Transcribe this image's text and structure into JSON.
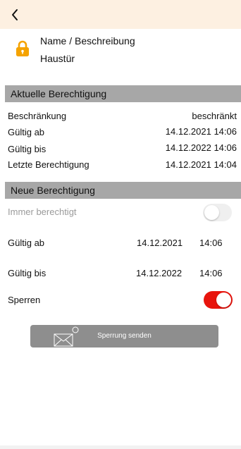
{
  "header": {
    "name_label": "Name / Beschreibung",
    "name_value": "Haustür"
  },
  "current": {
    "title": "Aktuelle Berechtigung",
    "rows": [
      {
        "label": "Beschränkung",
        "value": "beschränkt"
      },
      {
        "label": "Gültig ab",
        "value": "14.12.2021 14:06"
      },
      {
        "label": "Gültig bis",
        "value": "14.12.2022 14:06"
      },
      {
        "label": "Letzte Berechtigung",
        "value": "14.12.2021 14:04"
      }
    ]
  },
  "new": {
    "title": "Neue Berechtigung",
    "always_label": "Immer berechtigt",
    "always_on": false,
    "valid_from_label": "Gültig ab",
    "valid_from_date": "14.12.2021",
    "valid_from_time": "14:06",
    "valid_to_label": "Gültig bis",
    "valid_to_date": "14.12.2022",
    "valid_to_time": "14:06",
    "lock_label": "Sperren",
    "lock_on": true
  },
  "send_button": {
    "label": "Sperrung senden",
    "icon": "envelope-icon"
  },
  "colors": {
    "topbar": "#fdf0e1",
    "lock_icon": "#f5a300",
    "section_header": "#a7a7a7",
    "toggle_on": "#e8140d",
    "button": "#8e8e8e"
  }
}
